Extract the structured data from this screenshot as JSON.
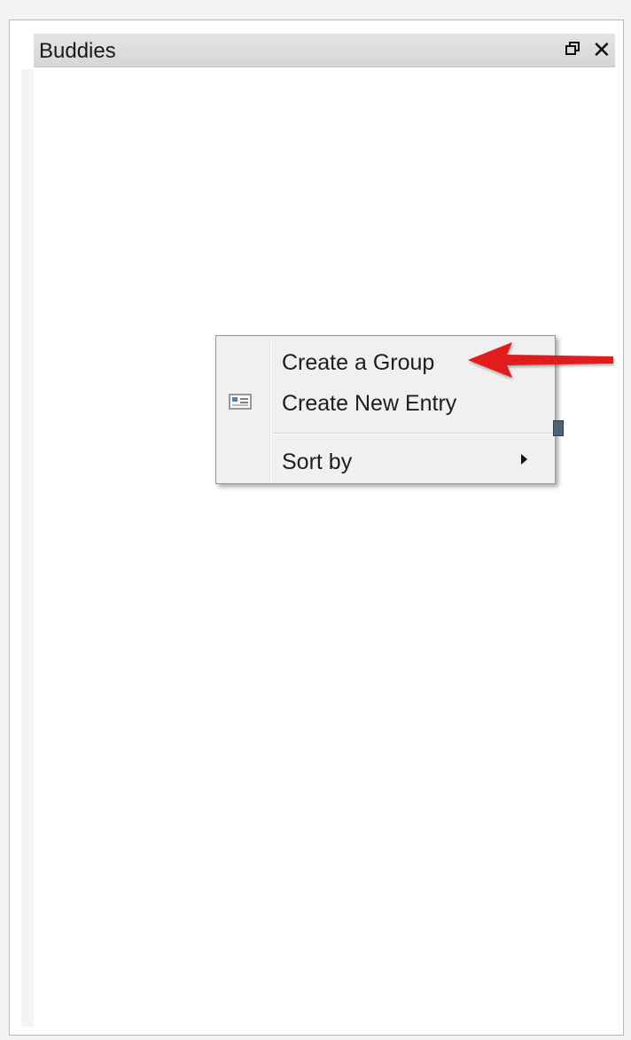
{
  "panel": {
    "title": "Buddies",
    "restore_icon": "restore-window-icon",
    "close_icon": "close-icon",
    "close_glyph": "✕"
  },
  "context_menu": {
    "items": [
      {
        "label": "Create a Group",
        "icon": null
      },
      {
        "label": "Create New Entry",
        "icon": "contact-card-icon"
      },
      {
        "label": "Sort by",
        "icon": null,
        "submenu": true
      }
    ]
  },
  "annotation": {
    "type": "arrow",
    "color": "#e01a1a",
    "points_to": "Create a Group"
  },
  "colors": {
    "header_bg": "#dcdcdc",
    "menu_bg": "#f0f0f0",
    "accent_arrow": "#e01a1a"
  }
}
